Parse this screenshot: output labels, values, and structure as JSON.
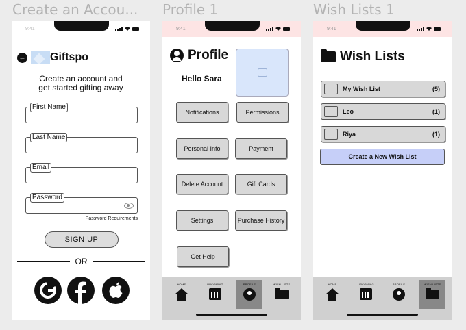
{
  "frames": {
    "signup": "Create an Accou...",
    "profile": "Profile 1",
    "wishlists": "Wish Lists 1"
  },
  "status_time": "9:41",
  "signup": {
    "logo": "Giftspo",
    "tagline_line1": "Create an account and",
    "tagline_line2": "get started gifting away",
    "fields": [
      "First Name",
      "Last Name",
      "Email",
      "Password"
    ],
    "password_requirements": "Password Requirements",
    "signup_button": "SIGN UP",
    "or": "OR",
    "social": [
      "google-icon",
      "facebook-icon",
      "apple-icon"
    ]
  },
  "profile": {
    "title": "Profile",
    "greeting": "Hello Sara",
    "buttons": [
      "Notifications",
      "Permissions",
      "Personal Info",
      "Payment",
      "Delete Account",
      "Gift Cards",
      "Settings",
      "Purchase History",
      "Get Help"
    ]
  },
  "nav": {
    "home": "HOME",
    "upcoming": "UPCOMING",
    "profile": "PROFILE",
    "wishlists": "WISH LISTS"
  },
  "wishlists": {
    "title": "Wish Lists",
    "lists": [
      {
        "name": "My Wish List",
        "count": "(5)"
      },
      {
        "name": "Leo",
        "count": "(1)"
      },
      {
        "name": "Riya",
        "count": "(1)"
      }
    ],
    "create_button": "Create a New Wish List"
  },
  "colors": {
    "status_pink": "#fde4e4",
    "create_button": "#c6cff8",
    "photo_placeholder": "#d9e6fb",
    "nav_active": "#888888"
  }
}
